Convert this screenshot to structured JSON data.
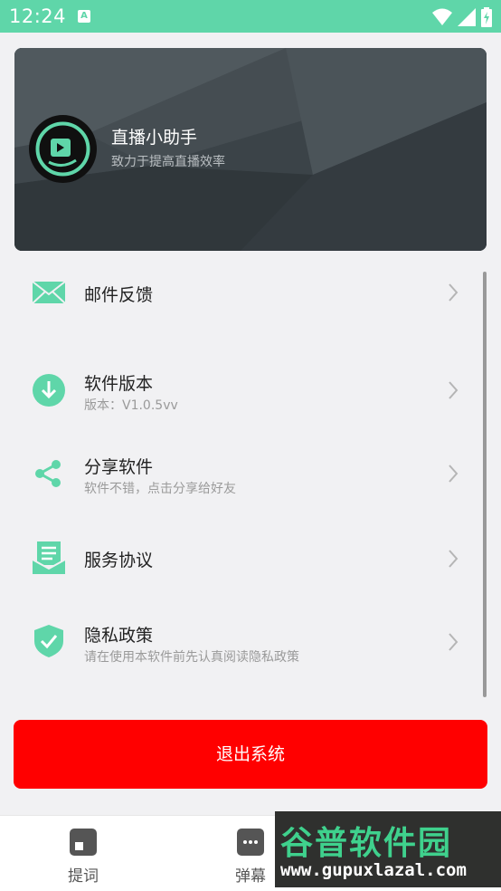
{
  "status_bar": {
    "time": "12:24",
    "notification_icon_letter": "A"
  },
  "header": {
    "app_name": "直播小助手",
    "tagline": "致力于提高直播效率"
  },
  "menu": [
    {
      "icon": "mail-icon",
      "title": "邮件反馈",
      "subtitle": ""
    },
    {
      "icon": "download-icon",
      "title": "软件版本",
      "subtitle": "版本：V1.0.5vv"
    },
    {
      "icon": "share-icon",
      "title": "分享软件",
      "subtitle": "软件不错，点击分享给好友"
    },
    {
      "icon": "document-icon",
      "title": "服务协议",
      "subtitle": ""
    },
    {
      "icon": "shield-check-icon",
      "title": "隐私政策",
      "subtitle": "请在使用本软件前先认真阅读隐私政策"
    }
  ],
  "logout_label": "退出系统",
  "bottom_nav": [
    {
      "icon": "prompt-icon",
      "label": "提词"
    },
    {
      "icon": "danmaku-icon",
      "label": "弹幕"
    }
  ],
  "watermark": {
    "brand": "谷普软件园",
    "url": "www.gupuxlazal.com"
  },
  "colors": {
    "accent": "#5fd6a9",
    "logout": "#ff0000",
    "header_bg": "#3c4449"
  }
}
